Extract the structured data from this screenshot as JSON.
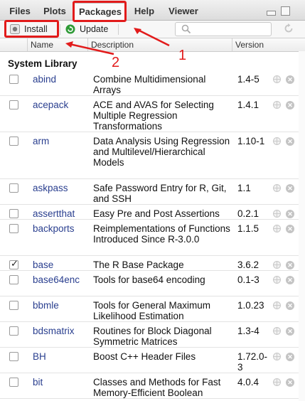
{
  "tabs": [
    "Files",
    "Plots",
    "Packages",
    "Help",
    "Viewer"
  ],
  "toolbar": {
    "install_label": "Install",
    "update_label": "Update",
    "search_placeholder": ""
  },
  "columns": [
    "Name",
    "Description",
    "Version"
  ],
  "section_title": "System Library",
  "packages": [
    {
      "name": "abind",
      "description": "Combine Multidimensional Arrays",
      "version": "1.4-5",
      "checked": false
    },
    {
      "name": "acepack",
      "description": "ACE and AVAS for Selecting Multiple Regression Transformations",
      "version": "1.4.1",
      "checked": false
    },
    {
      "name": "arm",
      "description": "Data Analysis Using Regression and Multilevel/Hierarchical Models",
      "version": "1.10-1",
      "checked": false
    },
    {
      "name": "askpass",
      "description": "Safe Password Entry for R, Git, and SSH",
      "version": "1.1",
      "checked": false
    },
    {
      "name": "assertthat",
      "description": "Easy Pre and Post Assertions",
      "version": "0.2.1",
      "checked": false
    },
    {
      "name": "backports",
      "description": "Reimplementations of Functions Introduced Since R-3.0.0",
      "version": "1.1.5",
      "checked": false
    },
    {
      "name": "base",
      "description": "The R Base Package",
      "version": "3.6.2",
      "checked": true
    },
    {
      "name": "base64enc",
      "description": "Tools for base64 encoding",
      "version": "0.1-3",
      "checked": false
    },
    {
      "name": "bbmle",
      "description": "Tools for General Maximum Likelihood Estimation",
      "version": "1.0.23",
      "checked": false
    },
    {
      "name": "bdsmatrix",
      "description": "Routines for Block Diagonal Symmetric Matrices",
      "version": "1.3-4",
      "checked": false
    },
    {
      "name": "BH",
      "description": "Boost C++ Header Files",
      "version": "1.72.0-3",
      "checked": false
    },
    {
      "name": "bit",
      "description": "Classes and Methods for Fast Memory-Efficient Boolean",
      "version": "4.0.4",
      "checked": false
    }
  ],
  "annotations": [
    "1",
    "2"
  ],
  "colors": {
    "highlight": "#e21b1b",
    "package_link": "#2a3f8f",
    "update_icon": "#2e9a36"
  }
}
